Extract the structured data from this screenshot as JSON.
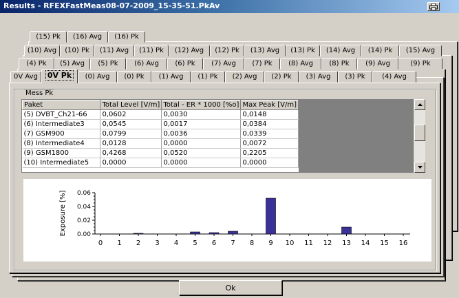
{
  "window": {
    "title": "Results - RFEXFastMeas08-07-2009_15-35-51.PkAv",
    "title_button_icon": "printer-icon"
  },
  "tabs": {
    "row1": [
      "(15) Pk",
      "(16) Avg",
      "(16) Pk"
    ],
    "row2": [
      "(10) Avg",
      "(10) Pk",
      "(11) Avg",
      "(11) Pk",
      "(12) Avg",
      "(12) Pk",
      "(13) Avg",
      "(13) Pk",
      "(14) Avg",
      "(14) Pk",
      "(15) Avg"
    ],
    "row3": [
      "(4) Pk",
      "(5) Avg",
      "(5) Pk",
      "(6) Avg",
      "(6) Pk",
      "(7) Avg",
      "(7) Pk",
      "(8) Avg",
      "(8) Pk",
      "(9) Avg",
      "(9) Pk"
    ],
    "row4": [
      "0V Avg",
      "0V Pk",
      "(0) Avg",
      "(0) Pk",
      "(1) Avg",
      "(1) Pk",
      "(2) Avg",
      "(2) Pk",
      "(3) Avg",
      "(3) Pk",
      "(4) Avg"
    ],
    "active": "0V Pk"
  },
  "group": {
    "label": "Mess Pk"
  },
  "table": {
    "columns": [
      "Paket",
      "Total Level [V/m]",
      "Total - ER * 1000 [%o]",
      "Max Peak [V/m]"
    ],
    "rows": [
      [
        "(5) DVBT_Ch21-66",
        "0,0602",
        "0,0030",
        "0,0148"
      ],
      [
        "(6) Intermediate3",
        "0,0545",
        "0,0017",
        "0,0384"
      ],
      [
        "(7) GSM900",
        "0,0799",
        "0,0036",
        "0,0339"
      ],
      [
        "(8) Intermediate4",
        "0,0128",
        "0,0000",
        "0,0072"
      ],
      [
        "(9) GSM1800",
        "0,4268",
        "0,0520",
        "0,2205"
      ],
      [
        "(10) Intermediate5",
        "0,0000",
        "0,0000",
        "0,0000"
      ]
    ]
  },
  "ok_button": {
    "label": "Ok"
  },
  "colors": {
    "bar": "#3a3296",
    "face": "#d4d0c8"
  },
  "chart_data": {
    "type": "bar",
    "ylabel": "Exposure [%]",
    "ylim": [
      0,
      0.06
    ],
    "yticks": [
      "0.00",
      "0.02",
      "0.04",
      "0.06"
    ],
    "categories": [
      "0",
      "1",
      "2",
      "3",
      "4",
      "5",
      "6",
      "7",
      "8",
      "9",
      "10",
      "11",
      "12",
      "13",
      "14",
      "15",
      "16"
    ],
    "values": [
      0,
      0,
      0.001,
      0,
      0,
      0.003,
      0.002,
      0.004,
      0,
      0.052,
      0,
      0,
      0,
      0.01,
      0,
      0,
      0
    ]
  }
}
